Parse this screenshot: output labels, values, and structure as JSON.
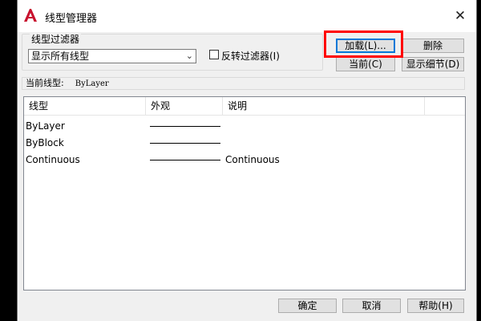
{
  "title": "线型管理器",
  "close_glyph": "✕",
  "filters": {
    "group_label": "线型过滤器",
    "selected": "显示所有线型",
    "invert_label": "反转过滤器(I)"
  },
  "buttons": {
    "load": "加载(L)...",
    "delete": "删除",
    "current": "当前(C)",
    "details": "显示细节(D)",
    "ok": "确定",
    "cancel": "取消",
    "help": "帮助(H)"
  },
  "current_linetype": {
    "label": "当前线型:",
    "value": "ByLayer"
  },
  "list": {
    "columns": [
      "线型",
      "外观",
      "说明"
    ],
    "rows": [
      {
        "name": "ByLayer",
        "desc": ""
      },
      {
        "name": "ByBlock",
        "desc": ""
      },
      {
        "name": "Continuous",
        "desc": "Continuous"
      }
    ]
  },
  "colors": {
    "highlight": "#ff0000",
    "app_icon": "#c8102e",
    "focus": "#0078d7"
  }
}
